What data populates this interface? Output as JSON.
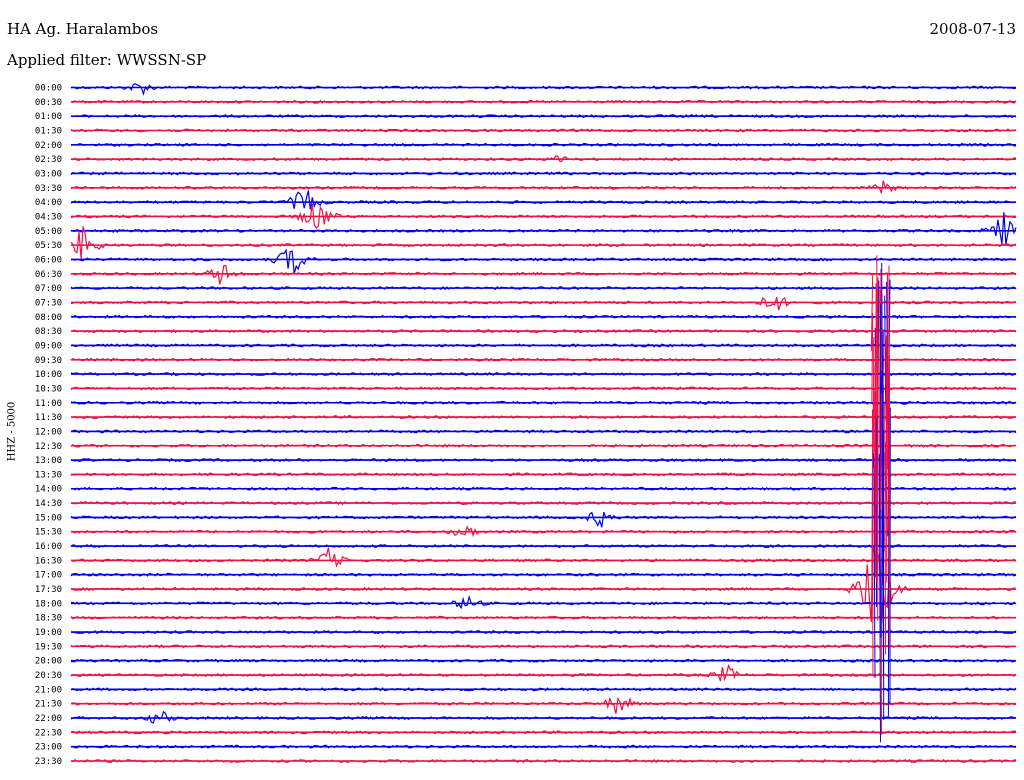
{
  "header": {
    "station": "HA Ag. Haralambos",
    "date": "2008-07-13",
    "filter": "Applied filter: WWSSN-SP",
    "channel": "HHZ - 5000"
  },
  "chart_data": {
    "type": "line",
    "title": "HA Ag. Haralambos",
    "date": "2008-07-13",
    "channel": "HHZ - 5000",
    "rows": [
      "00:00",
      "00:30",
      "01:00",
      "01:30",
      "02:00",
      "02:30",
      "03:00",
      "03:30",
      "04:00",
      "04:30",
      "05:00",
      "05:30",
      "06:00",
      "06:30",
      "07:00",
      "07:30",
      "08:00",
      "08:30",
      "09:00",
      "09:30",
      "10:00",
      "10:30",
      "11:00",
      "11:30",
      "12:00",
      "12:30",
      "13:00",
      "13:30",
      "14:00",
      "14:30",
      "15:00",
      "15:30",
      "16:00",
      "16:30",
      "17:00",
      "17:30",
      "18:00",
      "18:30",
      "19:00",
      "19:30",
      "20:00",
      "20:30",
      "21:00",
      "21:30",
      "22:00",
      "22:30",
      "23:00",
      "23:30"
    ],
    "colors": [
      "#0000ee",
      "#ee1144"
    ],
    "x_range_minutes": [
      0,
      30
    ],
    "events": [
      {
        "row": "00:00",
        "minute": 2.2,
        "amplitude": 9
      },
      {
        "row": "02:30",
        "minute": 15.6,
        "amplitude": 7
      },
      {
        "row": "03:30",
        "minute": 25.8,
        "amplitude": 8
      },
      {
        "row": "04:00",
        "minute": 7.4,
        "amplitude": 18
      },
      {
        "row": "04:30",
        "minute": 7.8,
        "amplitude": 22
      },
      {
        "row": "05:00",
        "minute": 29.6,
        "amplitude": 20
      },
      {
        "row": "05:30",
        "minute": 0.4,
        "amplitude": 22
      },
      {
        "row": "06:00",
        "minute": 7.0,
        "amplitude": 20
      },
      {
        "row": "06:30",
        "minute": 4.8,
        "amplitude": 14
      },
      {
        "row": "07:30",
        "minute": 22.3,
        "amplitude": 14
      },
      {
        "row": "15:00",
        "minute": 16.8,
        "amplitude": 12
      },
      {
        "row": "15:30",
        "minute": 12.5,
        "amplitude": 10
      },
      {
        "row": "16:30",
        "minute": 8.2,
        "amplitude": 14
      },
      {
        "row": "17:30",
        "minute": 25.6,
        "amplitude": 80
      },
      {
        "row": "18:00",
        "minute": 12.6,
        "amplitude": 10
      },
      {
        "row": "20:30",
        "minute": 20.8,
        "amplitude": 12
      },
      {
        "row": "21:30",
        "minute": 17.4,
        "amplitude": 14
      },
      {
        "row": "22:00",
        "minute": 2.8,
        "amplitude": 10
      }
    ]
  }
}
